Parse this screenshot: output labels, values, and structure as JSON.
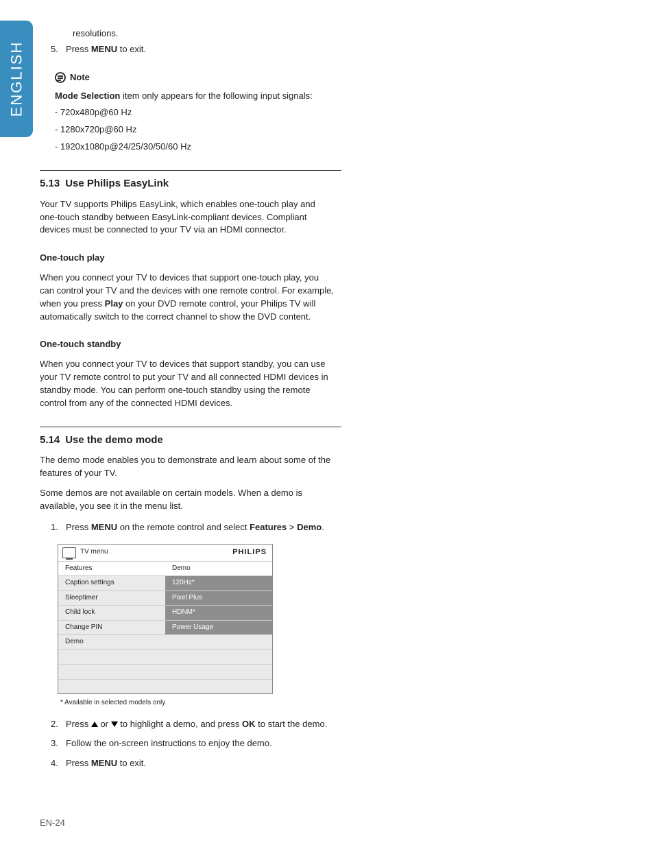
{
  "language_tab": "ENGLISH",
  "top": {
    "resolutions_cont": "resolutions.",
    "step5_num": "5.",
    "step5_a": "Press ",
    "step5_b": "MENU",
    "step5_c": " to exit."
  },
  "note": {
    "label": "Note",
    "line_a": "Mode Selection",
    "line_b": " item only appears for the following input signals:",
    "items": [
      "- 720x480p@60 Hz",
      "- 1280x720p@60 Hz",
      "- 1920x1080p@24/25/30/50/60 Hz"
    ]
  },
  "sec513": {
    "num": "5.13",
    "title": "Use Philips EasyLink",
    "intro": "Your TV supports Philips EasyLink, which enables one-touch play and one-touch standby between EasyLink-compliant devices.  Compliant devices must be connected to your TV via an HDMI connector.",
    "otp_head": "One-touch play",
    "otp_a": "When you connect your TV to devices that support one-touch play, you can control your TV and the devices with one remote control.  For example, when you press ",
    "otp_b": "Play",
    "otp_c": " on your DVD remote control, your Philips TV will automatically switch to the correct channel to show the DVD content.",
    "ots_head": "One-touch standby",
    "ots": "When you connect your TV to devices that support standby, you can use your TV remote control to put your TV and all connected HDMI devices in standby mode.  You can perform one-touch standby using the remote control from any of the connected HDMI devices."
  },
  "sec514": {
    "num": "5.14",
    "title": "Use the demo mode",
    "p1": "The demo mode enables you to demonstrate and learn about some of the features of your TV.",
    "p2": "Some demos are not available on certain models.  When a demo is available, you see it in the menu list.",
    "step1_num": "1.",
    "step1_a": "Press ",
    "step1_b": "MENU",
    "step1_c": " on the remote control and select ",
    "step1_d": "Features",
    "step1_e": " > ",
    "step1_f": "Demo",
    "step1_g": ".",
    "step2_num": "2.",
    "step2_a": "Press ",
    "step2_b": " or ",
    "step2_c": " to highlight a demo, and press ",
    "step2_d": "OK",
    "step2_e": " to start the demo.",
    "step3_num": "3.",
    "step3": "Follow the on-screen instructions to enjoy the demo.",
    "step4_num": "4.",
    "step4_a": "Press ",
    "step4_b": "MENU",
    "step4_c": " to exit."
  },
  "tvmenu": {
    "title": "TV menu",
    "brand": "PHILIPS",
    "col1head": "Features",
    "col2head": "Demo",
    "col1": [
      "Caption settings",
      "Sleeptimer",
      "Child lock",
      "Change PIN",
      "Demo",
      "",
      "",
      ""
    ],
    "col2": [
      "120Hz*",
      "Pixel Plus",
      "HDNM*",
      "Power Usage",
      "",
      "",
      "",
      ""
    ],
    "footnote": "* Available in selected models only"
  },
  "footer": "EN-24"
}
